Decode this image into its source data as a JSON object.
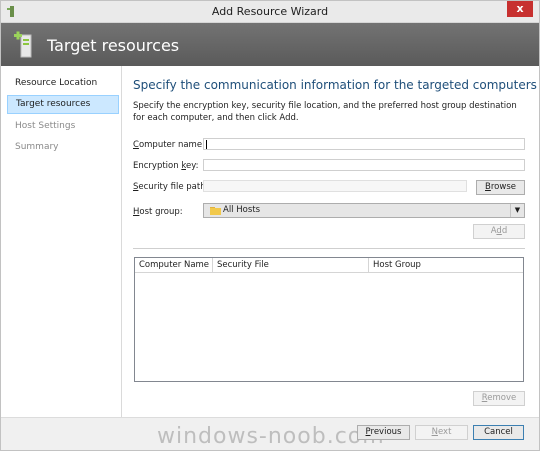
{
  "window": {
    "title": "Add Resource Wizard",
    "close_glyph": "x"
  },
  "header": {
    "title": "Target resources"
  },
  "sidebar": {
    "items": [
      {
        "label": "Resource Location",
        "state": "normal"
      },
      {
        "label": "Target resources",
        "state": "active"
      },
      {
        "label": "Host Settings",
        "state": "disabled"
      },
      {
        "label": "Summary",
        "state": "disabled"
      }
    ]
  },
  "main": {
    "heading": "Specify the communication information for the targeted computers",
    "description": "Specify the encryption key, security file location, and the preferred host group destination for each computer, and then click Add.",
    "computer_name": {
      "label_mnemonic": "C",
      "label_rest": "omputer name:",
      "value": ""
    },
    "encryption_key": {
      "label_prefix": "Encryption ",
      "label_mnemonic": "k",
      "label_rest": "ey:",
      "value": ""
    },
    "security_file": {
      "label_mnemonic": "S",
      "label_rest": "ecurity file path:",
      "value": ""
    },
    "browse_button": {
      "label_mnemonic": "B",
      "label_rest": "rowse"
    },
    "host_group": {
      "label_mnemonic": "H",
      "label_rest": "ost group:",
      "value": "All Hosts",
      "icon": "folder-icon"
    },
    "add_button": {
      "label_prefix": "A",
      "label_mnemonic": "d",
      "label_rest": "d"
    },
    "table": {
      "columns": [
        "Computer Name",
        "Security File",
        "Host Group"
      ],
      "rows": []
    },
    "remove_button": {
      "label_mnemonic": "R",
      "label_rest": "emove"
    }
  },
  "footer": {
    "previous_button": {
      "label_mnemonic": "P",
      "label_rest": "revious"
    },
    "next_button": {
      "label_mnemonic": "N",
      "label_rest": "ext"
    },
    "cancel_button": {
      "label": "Cancel"
    },
    "watermark": "windows-noob.com"
  },
  "colors": {
    "heading": "#1e4e79",
    "active_nav": "#cce8ff",
    "close": "#c7302f",
    "header_band": "#616161"
  }
}
